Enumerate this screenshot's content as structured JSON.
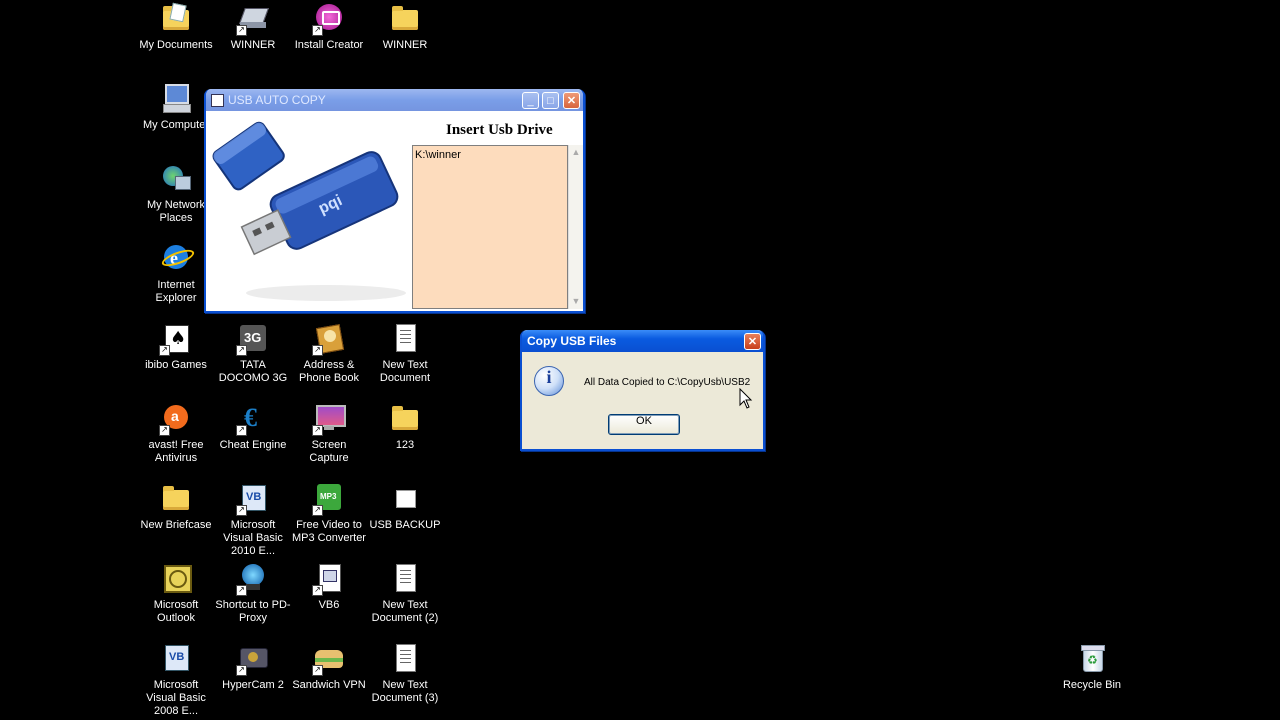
{
  "desktop": {
    "icons": [
      {
        "label": "My Documents",
        "icon": "my-documents-icon"
      },
      {
        "label": "WINNER",
        "icon": "winner-shortcut-icon"
      },
      {
        "label": "Install Creator",
        "icon": "install-creator-icon"
      },
      {
        "label": "WINNER",
        "icon": "folder-icon"
      },
      {
        "label": "My Computer",
        "icon": "my-computer-icon"
      },
      {
        "label": "My Network Places",
        "icon": "network-places-icon"
      },
      {
        "label": "Internet Explorer",
        "icon": "internet-explorer-icon"
      },
      {
        "label": "ibibo Games",
        "icon": "ibibo-games-icon"
      },
      {
        "label": "TATA DOCOMO 3G",
        "icon": "tata-docomo-icon"
      },
      {
        "label": "Address & Phone Book",
        "icon": "address-book-icon"
      },
      {
        "label": "New Text Document",
        "icon": "text-document-icon"
      },
      {
        "label": "avast! Free Antivirus",
        "icon": "avast-icon"
      },
      {
        "label": "Cheat Engine",
        "icon": "cheat-engine-icon"
      },
      {
        "label": "Screen Capture",
        "icon": "screen-capture-icon"
      },
      {
        "label": "123",
        "icon": "folder-icon"
      },
      {
        "label": "New Briefcase",
        "icon": "briefcase-icon"
      },
      {
        "label": "Microsoft Visual Basic 2010 E...",
        "icon": "visual-basic-icon"
      },
      {
        "label": "Free Video to MP3 Converter",
        "icon": "mp3-converter-icon"
      },
      {
        "label": "USB BACKUP",
        "icon": "usb-backup-icon"
      },
      {
        "label": "Microsoft Outlook",
        "icon": "outlook-icon"
      },
      {
        "label": "Shortcut to PD-Proxy",
        "icon": "pd-proxy-icon"
      },
      {
        "label": "VB6",
        "icon": "vb6-icon"
      },
      {
        "label": "New Text Document (2)",
        "icon": "text-document-icon"
      },
      {
        "label": "Microsoft Visual Basic 2008 E...",
        "icon": "visual-basic-icon"
      },
      {
        "label": "HyperCam 2",
        "icon": "hypercam-icon"
      },
      {
        "label": "Sandwich VPN",
        "icon": "sandwich-vpn-icon"
      },
      {
        "label": "New Text Document (3)",
        "icon": "text-document-icon"
      },
      {
        "label": "Recycle Bin",
        "icon": "recycle-bin-icon"
      }
    ]
  },
  "usb_window": {
    "title": "USB AUTO COPY",
    "heading": "Insert Usb Drive",
    "list_text": "K:\\winner",
    "image_icon": "usb-drive-image",
    "drive_brand": "pqi",
    "list_bg": "#fddcbd"
  },
  "dialog": {
    "title": "Copy USB Files",
    "message": "All Data Copied to C:\\CopyUsb\\USB2",
    "ok_label": "OK",
    "icon": "info-icon"
  },
  "colors": {
    "desktop": "#000000",
    "titlebar_active": "#0a4fd1",
    "window_face": "#ece9d8"
  }
}
